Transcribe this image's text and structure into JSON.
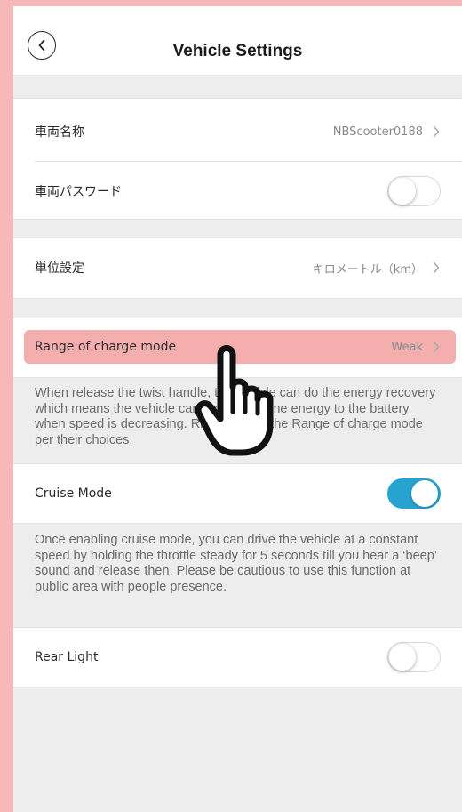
{
  "header": {
    "title": "Vehicle Settings"
  },
  "vehicle": {
    "name_label": "車両名称",
    "name_value": "NBScooter0188",
    "password_label": "車両パスワード",
    "password_enabled": false
  },
  "units": {
    "label": "単位設定",
    "value": "キロメートル（km）"
  },
  "charge_mode": {
    "label": "Range of charge mode",
    "value": "Weak",
    "description": "When release the twist handle, the vehicle can do the energy recovery which means the vehicle can recovery some energy to the battery when speed is decreasing. Rider can set the Range of charge mode per their choices."
  },
  "cruise": {
    "label": "Cruise Mode",
    "enabled": true,
    "description": "Once enabling cruise mode, you can drive the vehicle at a constant speed by holding the throttle steady for 5 seconds till you hear a ‘beep’ sound and release then. Please be cautious to use this function at public area with people presence."
  },
  "rear_light": {
    "label": "Rear Light",
    "enabled": false
  },
  "colors": {
    "accent": "#26a3cf",
    "highlight": "#f4aeae",
    "frame": "#f6b8b8"
  },
  "icons": {
    "back": "chevron-left-icon",
    "row_arrow": "chevron-right-icon",
    "tap_hint": "hand-pointer-icon"
  }
}
